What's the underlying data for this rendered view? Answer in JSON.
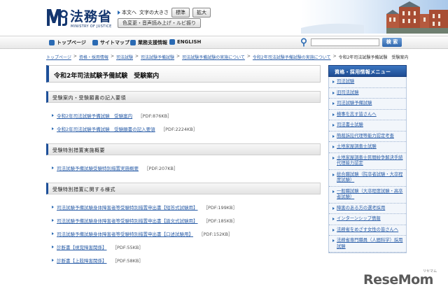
{
  "header": {
    "logo_title": "法務省",
    "logo_subtitle": "MINISTRY OF JUSTICE",
    "util": {
      "body_link": "本文へ",
      "font_size_label": "文字の大きさ",
      "standard_btn": "標準",
      "enlarge_btn": "拡大",
      "color_btn": "色変更・音声読み上げ・ルビ振り"
    }
  },
  "nav": {
    "items": [
      "トップページ",
      "サイトマップ",
      "業務支援情報",
      "ENGLISH"
    ],
    "search_button": "検 索",
    "search_placeholder": ""
  },
  "breadcrumb": [
    "トップページ",
    "資格・採用情報",
    "司法試験",
    "司法試験予備試験",
    "司法試験予備試験の実施について",
    "令和2年司法試験予備試験の実施について",
    "令和2年司法試験予備試験　受験案内"
  ],
  "main": {
    "title": "令和2年司法試験予備試験　受験案内",
    "sections": [
      {
        "heading": "受験案内・受験願書の記入要領",
        "items": [
          {
            "text": "令和2年司法試験予備試験　受験案内",
            "meta": "［PDF:876KB］"
          },
          {
            "text": "令和2年司法試験予備試験　受験願書の記入要領",
            "meta": "［PDF:2224KB］"
          }
        ]
      },
      {
        "heading": "受験特別措置実施概要",
        "items": [
          {
            "text": "司法試験予備試験受験特別措置実施概要",
            "meta": "［PDF:207KB］"
          }
        ]
      },
      {
        "heading": "受験特別措置に関する様式",
        "items": [
          {
            "text": "司法試験予備試験身体障害者等受験特別措置申出書【短答式試験用】",
            "meta": "［PDF:199KB］"
          },
          {
            "text": "司法試験予備試験身体障害者等受験特別措置申出書【論文式試験用】",
            "meta": "［PDF:185KB］"
          },
          {
            "text": "司法試験予備試験身体障害者等受験特別措置申出書【口述試験用】",
            "meta": "［PDF:152KB］"
          },
          {
            "text": "診断書【視覚障害関係】",
            "meta": "［PDF:55KB］"
          },
          {
            "text": "診断書【上肢障害関係】",
            "meta": "［PDF:58KB］"
          }
        ]
      }
    ]
  },
  "sidebar": {
    "heading": "資格・採用情報メニュー",
    "items": [
      "司法試験",
      "旧司法試験",
      "司法試験予備試験",
      "検事を志す皆さんへ",
      "司法書士試験",
      "簡裁訴訟代理等能力認定考査",
      "土地家屋調査士試験",
      "土地家屋調査士民間紛争解決手続代理能力認定",
      "総合職試験（院卒者試験・大卒程度試験）",
      "一般職試験（大卒程度試験・高卒者試験）",
      "障害のある方の選考採用",
      "インターンシップ情報",
      "法務省をめざす女性の皆さんへ",
      "法務省専門職員（人間科学）採用試験"
    ]
  },
  "watermark": {
    "text": "ReseMom",
    "sub": "リセマム"
  }
}
